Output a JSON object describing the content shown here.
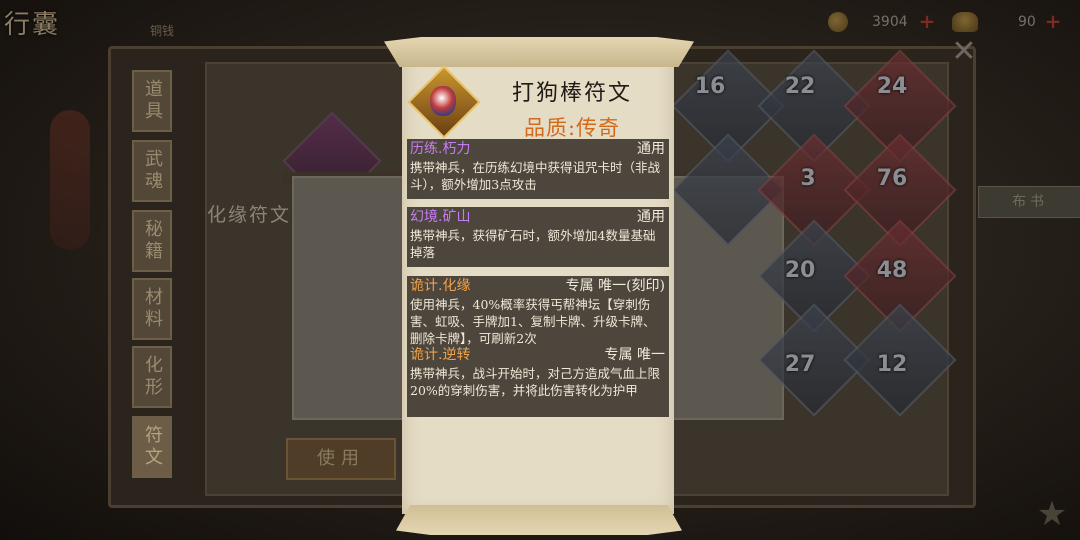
{
  "scene": {
    "top_left_title": "行囊",
    "top_left_sub": "铜钱",
    "top_left_badge": "",
    "currency_coin": "3904",
    "currency_ingot": "90",
    "plus": "+",
    "close": "✕",
    "side_tabs": [
      "道具",
      "武魂",
      "秘籍",
      "材料",
      "化形",
      "符文"
    ],
    "merge_label": "化缘符文",
    "use_button": "使用",
    "right_button": "布书",
    "grid_counts": [
      "16",
      "22",
      "24",
      "3",
      "76",
      "20",
      "48",
      "27",
      "12"
    ],
    "bottom_icon": "star-icon"
  },
  "tooltip": {
    "title": "打狗棒符文",
    "quality": "品质:传奇",
    "icon": "rune-gem-icon",
    "colors": {
      "purple": "#c87cf2",
      "orange": "#f0a24a",
      "quality": "#d26a1e"
    },
    "sections": [
      {
        "name": "历练.朽力",
        "scope": "通用",
        "desc": "携带神兵，在历练幻境中获得诅咒卡时（非战斗），额外增加3点攻击"
      },
      {
        "name": "幻境.矿山",
        "scope": "通用",
        "desc": "携带神兵，获得矿石时，额外增加4数量基础掉落"
      },
      {
        "name": "诡计.化缘",
        "scope": "专属 唯一(刻印)",
        "desc": "使用神兵，40%概率获得丐帮神坛【穿刺伤害、虹吸、手牌加1、复制卡牌、升级卡牌、删除卡牌】，可刷新2次"
      },
      {
        "name": "诡计.逆转",
        "scope": "专属 唯一",
        "desc": "携带神兵，战斗开始时，对己方造成气血上限20%的穿刺伤害，并将此伤害转化为护甲"
      }
    ]
  }
}
